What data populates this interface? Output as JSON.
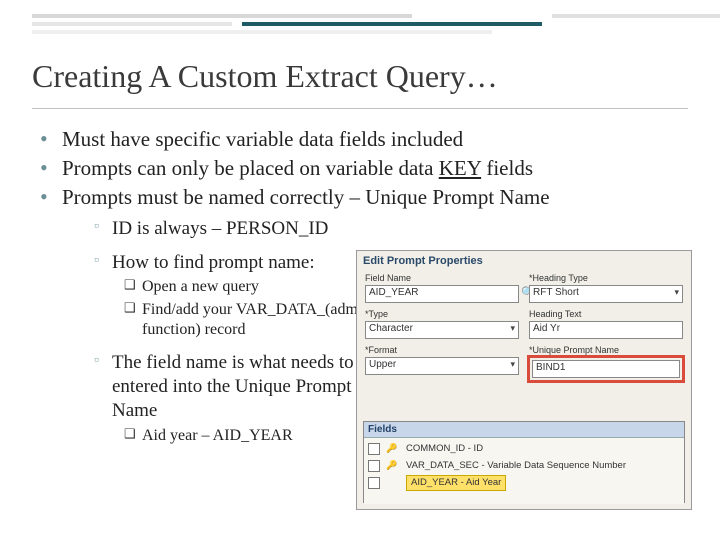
{
  "title": "Creating A Custom Extract Query…",
  "bullets": {
    "b1": "Must have specific variable data fields included",
    "b2_pre": "Prompts can only be placed on variable data ",
    "b2_key": "KEY",
    "b2_post": " fields",
    "b3": "Prompts must be named correctly – Unique Prompt Name"
  },
  "sub": {
    "s1": "ID is always – PERSON_ID",
    "s2": "How to find prompt name:",
    "s2a": "Open a new query",
    "s2b": "Find/add your VAR_DATA_(admin function) record",
    "s3": "The field name is what needs to be entered into the Unique Prompt Name",
    "s3a": "Aid year – AID_YEAR"
  },
  "dialog": {
    "title": "Edit Prompt Properties",
    "labels": {
      "fieldname": "Field Name",
      "headingtype": "Heading Type",
      "type": "Type",
      "headingtext": "Heading Text",
      "format": "Format",
      "upn": "Unique Prompt Name"
    },
    "values": {
      "fieldname": "AID_YEAR",
      "headingtype": "RFT Short",
      "type": "Character",
      "headingtext": "Aid Yr",
      "format": "Upper",
      "upn": "BIND1"
    },
    "fields_header": "Fields",
    "rows": [
      {
        "key": true,
        "text": "COMMON_ID - ID"
      },
      {
        "key": true,
        "text": "VAR_DATA_SEC - Variable Data Sequence Number"
      },
      {
        "key": false,
        "text": "AID_YEAR - Aid Year",
        "highlight": true
      }
    ]
  }
}
